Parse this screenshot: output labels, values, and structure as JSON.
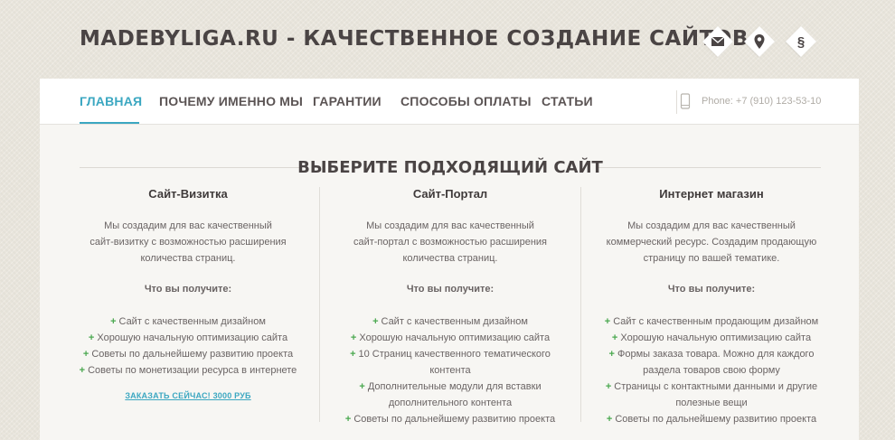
{
  "header": {
    "site_title": "MADEBYLIGA.RU - КАЧЕСТВЕННОЕ СОЗДАНИЕ САЙТОВ",
    "social_icons": [
      "mail-icon",
      "location-icon",
      "section-icon"
    ],
    "section_symbol": "§"
  },
  "nav": {
    "items": [
      {
        "label": "ГЛАВНАЯ",
        "active": true
      },
      {
        "label": "ПОЧЕМУ ИМЕННО МЫ",
        "active": false
      },
      {
        "label": "ГАРАНТИИ",
        "active": false
      },
      {
        "label": "СПОСОБЫ ОПЛАТЫ",
        "active": false
      },
      {
        "label": "СТАТЬИ",
        "active": false
      }
    ],
    "phone": "Phone: +7 (910) 123-53-10"
  },
  "main": {
    "section_title": "ВЫБЕРИТЕ ПОДХОДЯЩИЙ САЙТ",
    "columns": [
      {
        "title": "Сайт-Визитка",
        "desc": [
          "Мы создадим для вас качественный",
          "сайт-визитку с возможностью расширения",
          "количества страниц."
        ],
        "get_label": "Что вы получите:",
        "features": [
          "Сайт с качественным дизайном",
          "Хорошую начальную оптимизацию сайта",
          "Советы по дальнейшему развитию проекта",
          "Советы по монетизации ресурса в интернете"
        ],
        "order_label": "ЗАКАЗАТЬ СЕЙЧАС! 3000 РУБ"
      },
      {
        "title": "Сайт-Портал",
        "desc": [
          "Мы создадим для вас качественный",
          "сайт-портал с возможностью расширения",
          "количества страниц."
        ],
        "get_label": "Что вы получите:",
        "features": [
          "Сайт с качественным дизайном",
          "Хорошую начальную оптимизацию сайта",
          "10 Страниц качественного тематического контента",
          "Дополнительные модули для вставки дополнительного контента",
          "Советы по дальнейшему развитию проекта"
        ]
      },
      {
        "title": "Интернет магазин",
        "desc": [
          "Мы создадим для вас качественный",
          "коммерческий ресурс. Создадим продающую",
          "страницу по вашей тематике."
        ],
        "get_label": "Что вы получите:",
        "features": [
          "Сайт с качественным продающим дизайном",
          "Хорошую начальную оптимизацию сайта",
          "Формы заказа товара. Можно для каждого раздела товаров свою форму",
          "Страницы с контактными данными и другие полезные вещи",
          "Советы по дальнейшему развитию проекта"
        ]
      }
    ]
  },
  "colors": {
    "accent": "#3ba7c1",
    "plus": "#4aa84f",
    "title": "#4a4444",
    "background": "#e9e5dc"
  }
}
